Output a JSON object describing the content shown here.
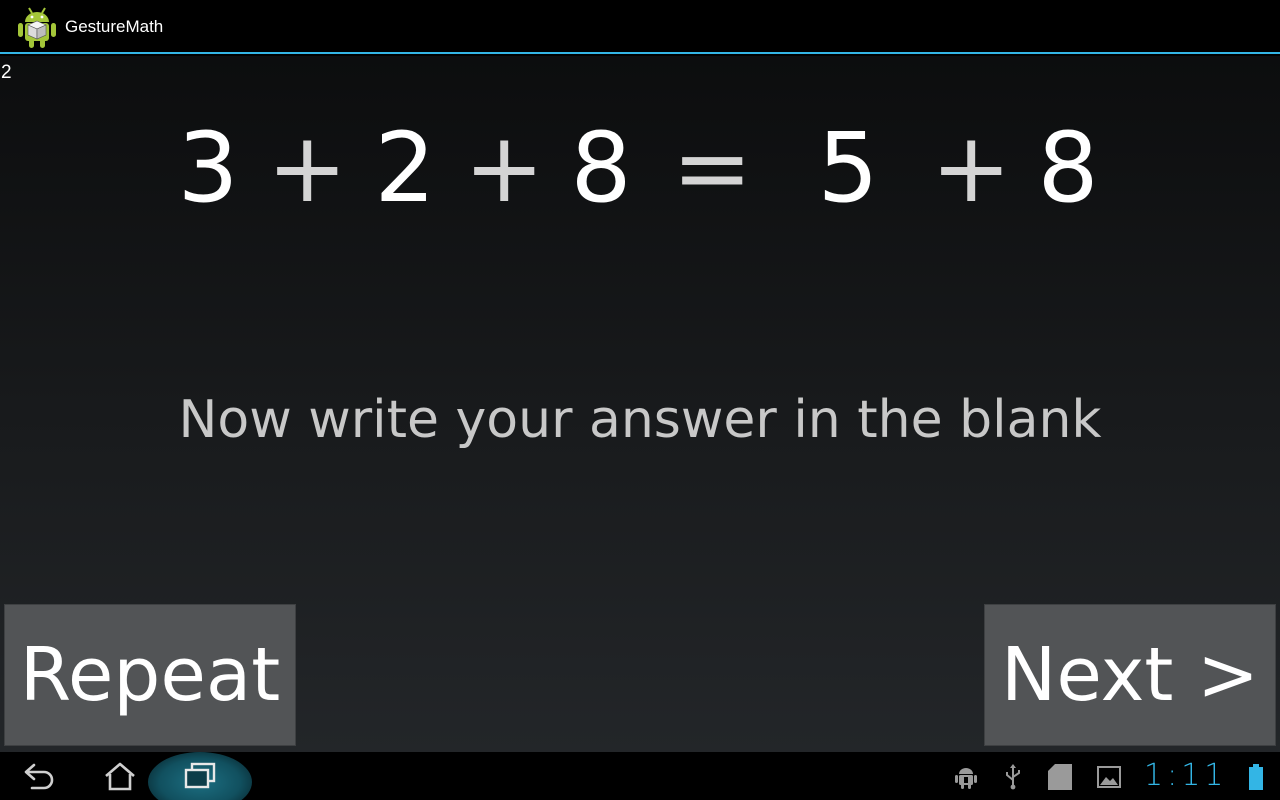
{
  "app": {
    "title": "GestureMath"
  },
  "counter": "2",
  "equation": {
    "tokens": [
      {
        "text": "3",
        "kind": "num"
      },
      {
        "text": "+",
        "kind": "op"
      },
      {
        "text": "2",
        "kind": "num"
      },
      {
        "text": "+",
        "kind": "op"
      },
      {
        "text": "8",
        "kind": "num"
      },
      {
        "text": "=",
        "kind": "op"
      },
      {
        "text": "5",
        "kind": "num"
      },
      {
        "text": "+",
        "kind": "op"
      },
      {
        "text": "8",
        "kind": "num"
      }
    ]
  },
  "prompt": "Now write your answer in the blank",
  "buttons": {
    "repeat": "Repeat",
    "next": "Next >"
  },
  "system_bar": {
    "clock": "1:11",
    "icons": [
      "back-icon",
      "home-icon",
      "recent-apps-icon",
      "android-debug-icon",
      "usb-icon",
      "sd-card-icon",
      "screenshot-icon",
      "battery-icon"
    ]
  },
  "colors": {
    "accent": "#33b5e5",
    "button": "#525456",
    "background": "#000000"
  }
}
